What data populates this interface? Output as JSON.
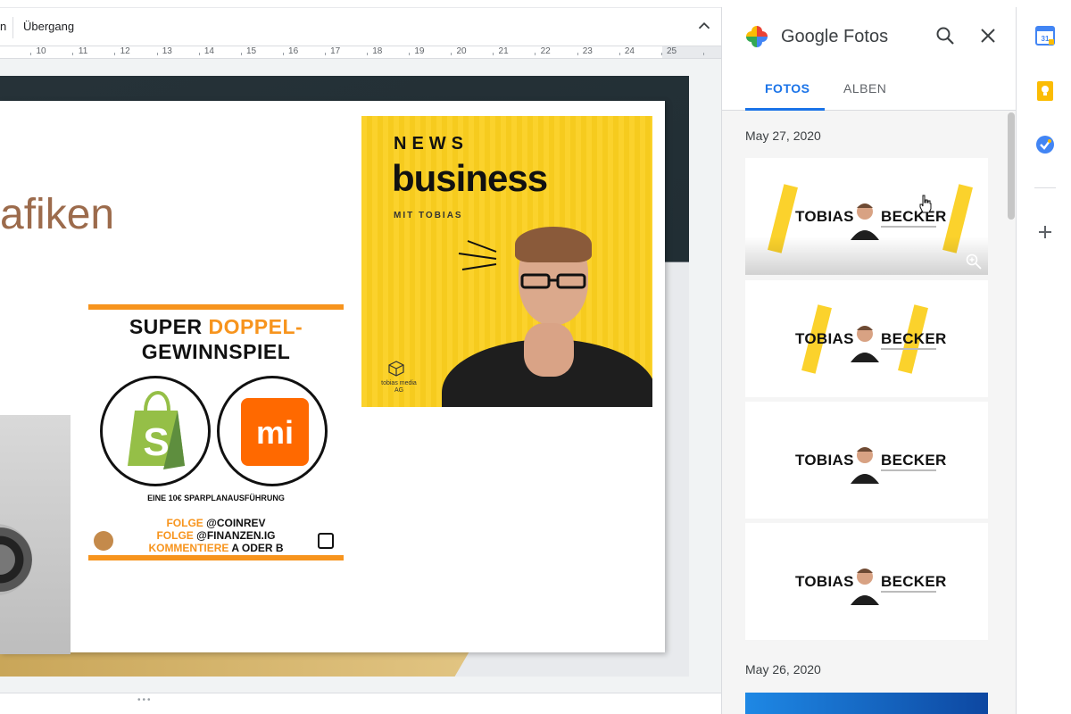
{
  "toolbar": {
    "partial_label": "n",
    "transition_label": "Übergang"
  },
  "ruler": {
    "numbers": [
      "10",
      "11",
      "12",
      "13",
      "14",
      "15",
      "16",
      "17",
      "18",
      "19",
      "20",
      "21",
      "22",
      "23",
      "24",
      "25"
    ]
  },
  "slide": {
    "title_fragment": "afiken"
  },
  "giveaway": {
    "line1_prefix": "SUPER ",
    "line1_accent": "DOPPEL-",
    "line2": "GEWINNSPIEL",
    "mi_label": "mi",
    "small": "EINE 10€ SPARPLANAUSFÜHRUNG",
    "follow1_accent": "FOLGE ",
    "follow1_rest": "@COINREV",
    "follow2_accent": "FOLGE ",
    "follow2_rest": "@FINANZEN.IG",
    "follow3_accent": "KOMMENTIERE ",
    "follow3_rest": "A ODER B"
  },
  "news": {
    "line1": "NEWS",
    "line2": "business",
    "line3": "MIT TOBIAS",
    "brand": "tobias media AG"
  },
  "panel": {
    "title": "Google Fotos",
    "tabs": [
      {
        "label": "FOTOS",
        "active": true
      },
      {
        "label": "ALBEN",
        "active": false
      }
    ],
    "dates": [
      "May 27, 2020",
      "May 26, 2020"
    ],
    "thumb_name_left": "TOBIAS",
    "thumb_name_right": "BECKER"
  },
  "colors": {
    "accent_blue": "#1a73e8",
    "giveaway_orange": "#f7941d",
    "news_yellow": "#fbd22c",
    "title_brown": "#9c6b4c"
  },
  "icons": {
    "search": "search-icon",
    "close": "close-icon",
    "collapse": "chevron-up-icon",
    "zoom": "zoom-in-icon",
    "calendar": "google-calendar-icon",
    "keep": "google-keep-icon",
    "tasks": "google-tasks-icon",
    "add": "plus-icon"
  }
}
